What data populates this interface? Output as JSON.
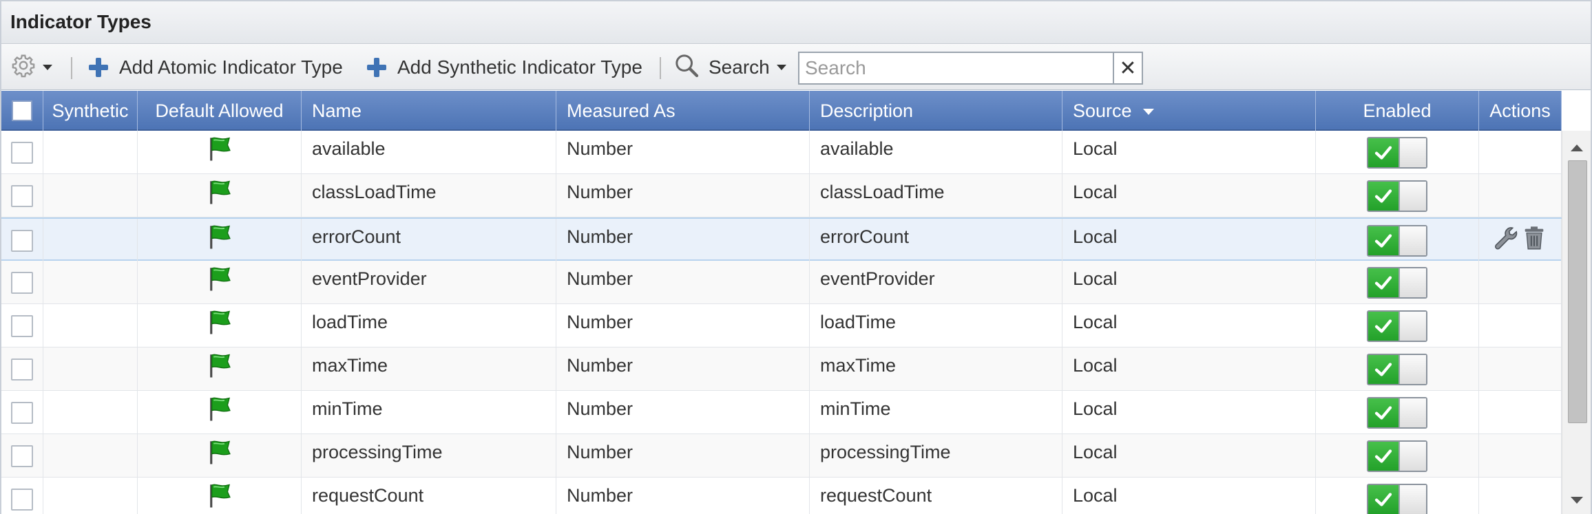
{
  "panel": {
    "title": "Indicator Types"
  },
  "toolbar": {
    "add_atomic_label": "Add Atomic Indicator Type",
    "add_synthetic_label": "Add Synthetic Indicator Type",
    "search_menu_label": "Search",
    "search_placeholder": "Search",
    "clear_glyph": "✕"
  },
  "columns": {
    "synthetic": "Synthetic",
    "default_allowed": "Default Allowed",
    "name": "Name",
    "measured_as": "Measured As",
    "description": "Description",
    "source": "Source",
    "enabled": "Enabled",
    "actions": "Actions"
  },
  "rows": [
    {
      "name": "available",
      "measured_as": "Number",
      "description": "available",
      "source": "Local",
      "enabled": true
    },
    {
      "name": "classLoadTime",
      "measured_as": "Number",
      "description": "classLoadTime",
      "source": "Local",
      "enabled": true
    },
    {
      "name": "errorCount",
      "measured_as": "Number",
      "description": "errorCount",
      "source": "Local",
      "enabled": true
    },
    {
      "name": "eventProvider",
      "measured_as": "Number",
      "description": "eventProvider",
      "source": "Local",
      "enabled": true
    },
    {
      "name": "loadTime",
      "measured_as": "Number",
      "description": "loadTime",
      "source": "Local",
      "enabled": true
    },
    {
      "name": "maxTime",
      "measured_as": "Number",
      "description": "maxTime",
      "source": "Local",
      "enabled": true
    },
    {
      "name": "minTime",
      "measured_as": "Number",
      "description": "minTime",
      "source": "Local",
      "enabled": true
    },
    {
      "name": "processingTime",
      "measured_as": "Number",
      "description": "processingTime",
      "source": "Local",
      "enabled": true
    },
    {
      "name": "requestCount",
      "measured_as": "Number",
      "description": "requestCount",
      "source": "Local",
      "enabled": true
    }
  ],
  "highlighted_row": 2,
  "icons": {
    "settings": "gear-icon",
    "add": "plus-icon",
    "search": "magnifier-icon",
    "default_allowed": "green-flag-icon",
    "enabled": "checkmark-toggle",
    "edit": "wrench-icon",
    "delete": "trash-icon"
  },
  "colors": {
    "header_blue": "#5a7fbf",
    "toggle_green": "#2fae35",
    "add_blue": "#3f73b5",
    "flag_green": "#1c9e1c",
    "highlight_row": "#eaf1fa"
  }
}
